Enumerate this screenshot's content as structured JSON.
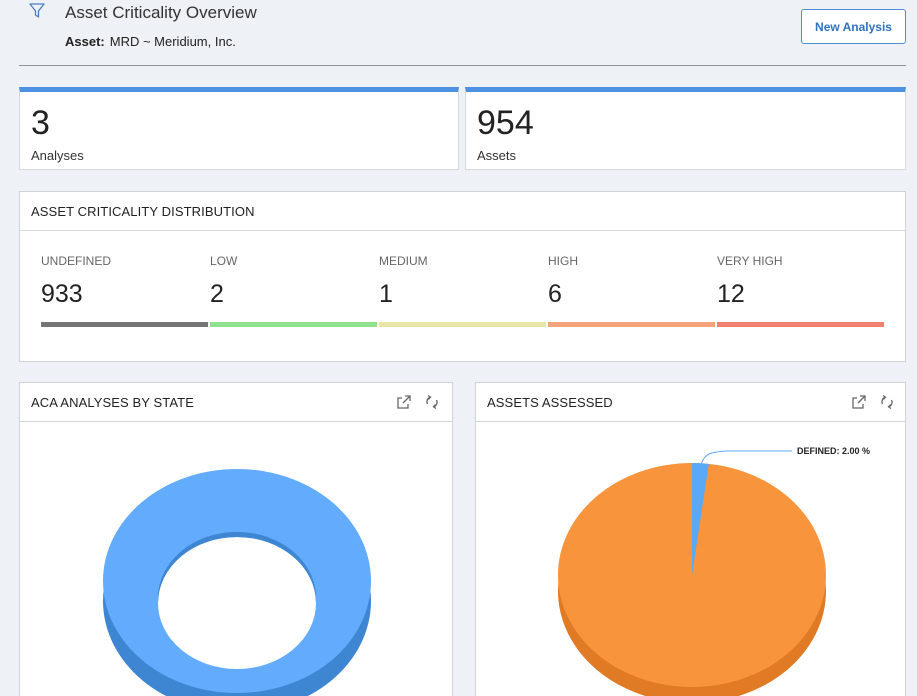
{
  "header": {
    "title": "Asset Criticality Overview",
    "asset_label": "Asset:",
    "asset_value": "MRD ~ Meridium, Inc.",
    "new_analysis_label": "New Analysis"
  },
  "kpis": [
    {
      "value": "3",
      "caption": "Analyses"
    },
    {
      "value": "954",
      "caption": "Assets"
    }
  ],
  "distribution": {
    "title": "ASSET CRITICALITY DISTRIBUTION",
    "items": [
      {
        "label": "UNDEFINED",
        "value": "933",
        "color": "#767676"
      },
      {
        "label": "LOW",
        "value": "2",
        "color": "#8ee28e"
      },
      {
        "label": "MEDIUM",
        "value": "1",
        "color": "#e6e6a6"
      },
      {
        "label": "HIGH",
        "value": "6",
        "color": "#f4a47a"
      },
      {
        "label": "VERY HIGH",
        "value": "12",
        "color": "#f08070"
      }
    ]
  },
  "panels": {
    "analyses_by_state": {
      "title": "ACA ANALYSES BY STATE"
    },
    "assets_assessed": {
      "title": "ASSETS ASSESSED"
    }
  },
  "icons": [
    "filter-icon",
    "open-external-icon",
    "refresh-icon"
  ],
  "chart_data": [
    {
      "type": "pie",
      "title": "ACA ANALYSES BY STATE",
      "style": "3d-donut",
      "slices": [
        {
          "value": 100,
          "color": "#62abfd"
        }
      ]
    },
    {
      "type": "pie",
      "title": "ASSETS ASSESSED",
      "style": "3d-pie",
      "slices": [
        {
          "label": "DEFINED",
          "value": 2.0,
          "unit": "%",
          "color": "#5aa8f8"
        },
        {
          "value": 98.0,
          "color": "#f7943c"
        }
      ],
      "annotations": [
        "DEFINED: 2.00 %"
      ]
    }
  ]
}
